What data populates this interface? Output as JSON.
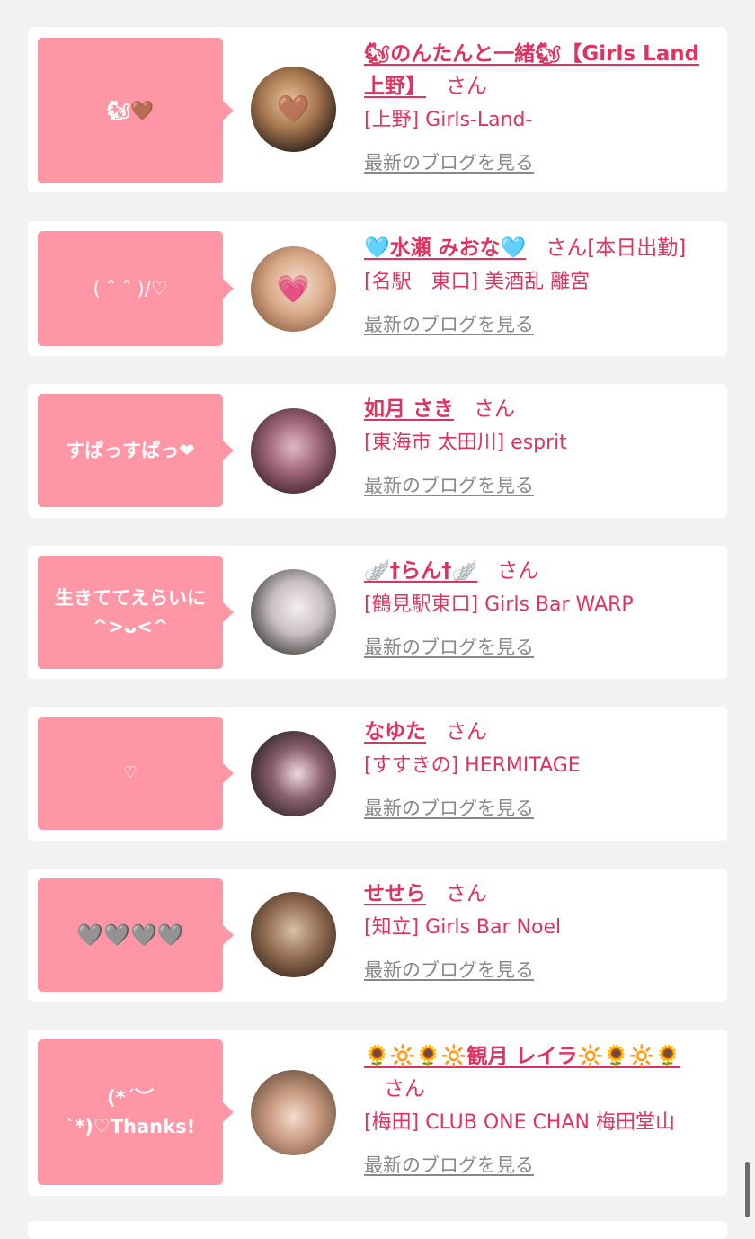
{
  "accent_color": "#e0325e",
  "bubble_color": "#ff96a6",
  "entries": [
    {
      "message": "🐿🤎",
      "name": "🐿のんたんと一緒🐿【Girls Land 上野】",
      "suffix": "さん",
      "shop": "[上野] Girls-Land-",
      "blog_link": "最新のブログを見る"
    },
    {
      "message": "( ˆ ˆ )/♡",
      "name": "🩵水瀬 みおな🩵",
      "suffix": "さん[本日出勤]",
      "shop": "[名駅　東口] 美酒乱 離宮",
      "blog_link": "最新のブログを見る"
    },
    {
      "message": "すぱっすぱっ❤",
      "name": "如月 さき",
      "suffix": "さん",
      "shop": "[東海市 太田川] esprit",
      "blog_link": "最新のブログを見る"
    },
    {
      "message": "生きててえらいに\n^>ᴗ<^",
      "name": "🪽†らん†🪽",
      "suffix": "さん",
      "shop": "[鶴見駅東口] Girls Bar WARP",
      "blog_link": "最新のブログを見る"
    },
    {
      "message": "♡",
      "name": "なゆた",
      "suffix": "さん",
      "shop": "[すすきの] HERMITAGE",
      "blog_link": "最新のブログを見る"
    },
    {
      "message": "🩶🩶🩶🩶",
      "name": "せせら",
      "suffix": "さん",
      "shop": "[知立] Girls Bar Noel",
      "blog_link": "最新のブログを見る"
    },
    {
      "message": "(*´︶`*)♡Thanks!",
      "name": "🌻🔆🌻🔆観月 レイラ🔆🌻🔆🌻",
      "suffix": "さん",
      "shop": "[梅田] CLUB ONE CHAN 梅田堂山",
      "blog_link": "最新のブログを見る"
    }
  ]
}
